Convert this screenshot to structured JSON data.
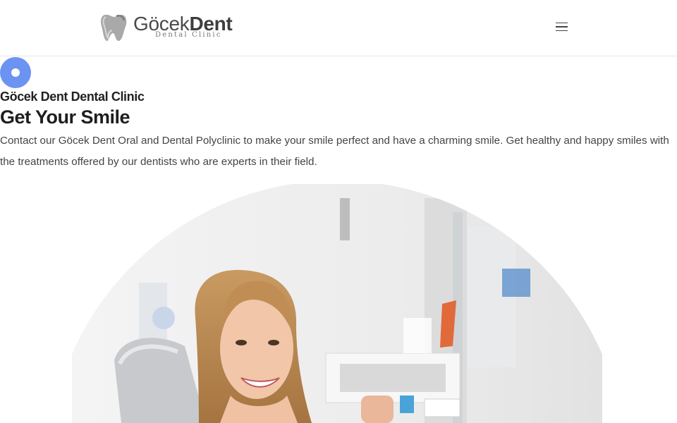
{
  "header": {
    "logo": {
      "name_light": "Göcek",
      "name_bold": "Dent",
      "tagline": "Dental Clinic",
      "icon": "tooth-icon"
    },
    "menu": {
      "icon": "hamburger-menu-icon"
    }
  },
  "hero": {
    "badge_icon": "dot-badge-icon",
    "eyebrow": "Göcek Dent Dental Clinic",
    "title": "Get Your Smile",
    "description": "Contact our Göcek Dent Oral and Dental Polyclinic to make your smile perfect and have a charming smile. Get healthy and happy smiles with the treatments offered by our dentists who are experts in their field.",
    "image_subject": "smiling patient in dental chair"
  },
  "colors": {
    "accent": "#6b93f2",
    "text_dark": "#1e1e1e",
    "text_body": "#444444",
    "header_border": "#e6e6e6"
  }
}
